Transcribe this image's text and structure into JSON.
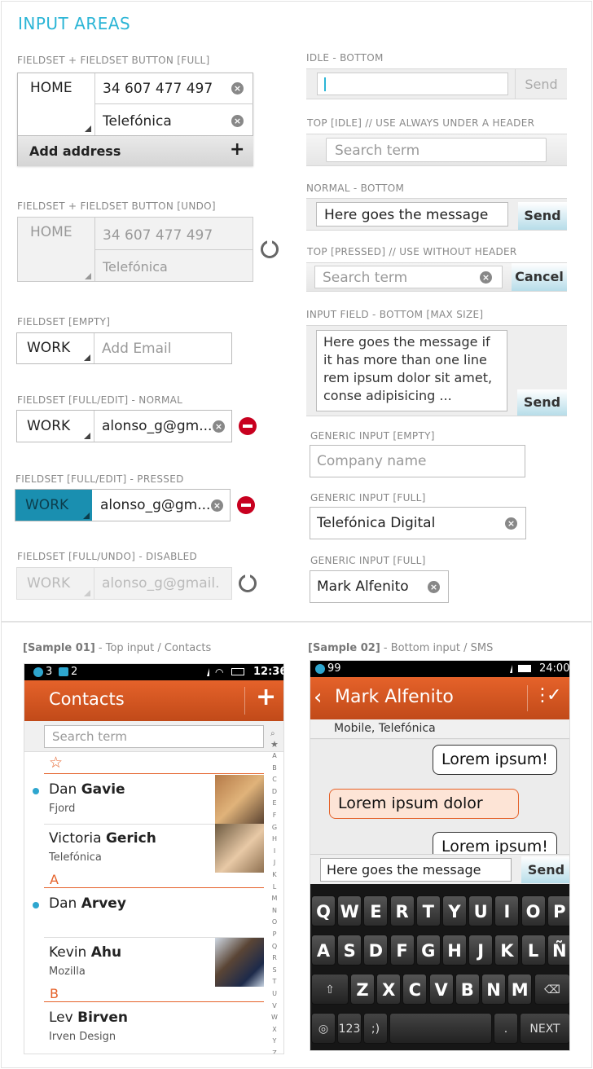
{
  "top": {
    "title": "INPUT AREAS",
    "left": {
      "s1": {
        "label": "FIELDSET + FIELDSET BUTTON [FULL]",
        "type": "HOME",
        "phone": "34 607 477 497",
        "carrier": "Telefónica",
        "button": "Add address",
        "button_icon": "+"
      },
      "s2": {
        "label": "FIELDSET + FIELDSET BUTTON [UNDO]",
        "type": "HOME",
        "phone": "34 607 477 497",
        "carrier": "Telefónica"
      },
      "s3": {
        "label": "FIELDSET [EMPTY]",
        "type": "WORK",
        "placeholder": "Add Email"
      },
      "s4": {
        "label": "FIELDSET [FULL/EDIT] - NORMAL",
        "type": "WORK",
        "value": "alonso_g@gm..."
      },
      "s5": {
        "label": "FIELDSET [FULL/EDIT] - PRESSED",
        "type": "WORK",
        "value": "alonso_g@gm..."
      },
      "s6": {
        "label": "FIELDSET [FULL/UNDO] - DISABLED",
        "type": "WORK",
        "value": "alonso_g@gmail."
      }
    },
    "right": {
      "r1": {
        "label": "IDLE - BOTTOM",
        "button": "Send"
      },
      "r2": {
        "label": "TOP [IDLE] // USE ALWAYS UNDER A HEADER",
        "placeholder": "Search term"
      },
      "r3": {
        "label": "NORMAL - BOTTOM",
        "value": "Here goes the message",
        "button": "Send"
      },
      "r4": {
        "label": "TOP [PRESSED] // USE WITHOUT HEADER",
        "placeholder": "Search term",
        "button": "Cancel"
      },
      "r5": {
        "label": "INPUT FIELD - BOTTOM [MAX SIZE]",
        "lines": [
          "Here goes the message if",
          "it has more than one line",
          "rem ipsum dolor sit amet,",
          "conse adipisicing ..."
        ],
        "button": "Send"
      },
      "r6": {
        "label": "GENERIC INPUT [EMPTY]",
        "placeholder": "Company name"
      },
      "r7": {
        "label": "GENERIC INPUT [FULL]",
        "value": "Telefónica Digital"
      },
      "r8": {
        "label": "GENERIC INPUT [FULL]",
        "value": "Mark Alfenito"
      }
    }
  },
  "sample1": {
    "caption_tag": "[Sample 01]",
    "caption_text": " - Top input / Contacts",
    "status": {
      "sms": "3",
      "chat": "2",
      "time": "12:36"
    },
    "header_title": "Contacts",
    "add_icon": "+",
    "search_placeholder": "Search term",
    "fav_icon": "☆",
    "contacts": [
      {
        "first": "Dan ",
        "last": "Gavie",
        "sub": "Fjord"
      },
      {
        "first": "Victoria ",
        "last": "Gerich",
        "sub": "Telefónica"
      },
      {
        "first": "Dan ",
        "last": "Arvey",
        "sub": ""
      },
      {
        "first": "Kevin ",
        "last": "Ahu",
        "sub": "Mozilla"
      },
      {
        "first": "Lev ",
        "last": "Birven",
        "sub": "Irven Design"
      }
    ],
    "sections": [
      "A",
      "B"
    ],
    "alphabet": [
      "A",
      "B",
      "C",
      "D",
      "E",
      "F",
      "G",
      "H",
      "I",
      "J",
      "K",
      "L",
      "M",
      "N",
      "O",
      "P",
      "Q",
      "R",
      "S",
      "T",
      "U",
      "V",
      "W",
      "X",
      "Y",
      "Z"
    ]
  },
  "sample2": {
    "caption_tag": "[Sample 02]",
    "caption_text": " - Bottom input / SMS",
    "status": {
      "sms": "99",
      "time": "24:00"
    },
    "header_title": "Mark Alfenito",
    "subheader": "Mobile, Telefónica",
    "bubbles": [
      "Lorem ipsum!",
      "Lorem ipsum dolor",
      "Lorem ipsum!"
    ],
    "input_value": "Here goes the message",
    "send": "Send",
    "keys_row1": [
      "Q",
      "W",
      "E",
      "R",
      "T",
      "Y",
      "U",
      "I",
      "O",
      "P"
    ],
    "keys_row2": [
      "A",
      "S",
      "D",
      "F",
      "G",
      "H",
      "J",
      "K",
      "L",
      "Ñ"
    ],
    "keys_row3": [
      "Z",
      "X",
      "C",
      "V",
      "B",
      "N",
      "M"
    ],
    "key_123": "123",
    "key_smiley": ";)",
    "key_dot": ".",
    "key_next": "NEXT"
  },
  "colors": {
    "accent": "#2bb5d6",
    "orange": "#e5622a",
    "pressed": "#1a8fb0",
    "delete": "#c8001f"
  }
}
